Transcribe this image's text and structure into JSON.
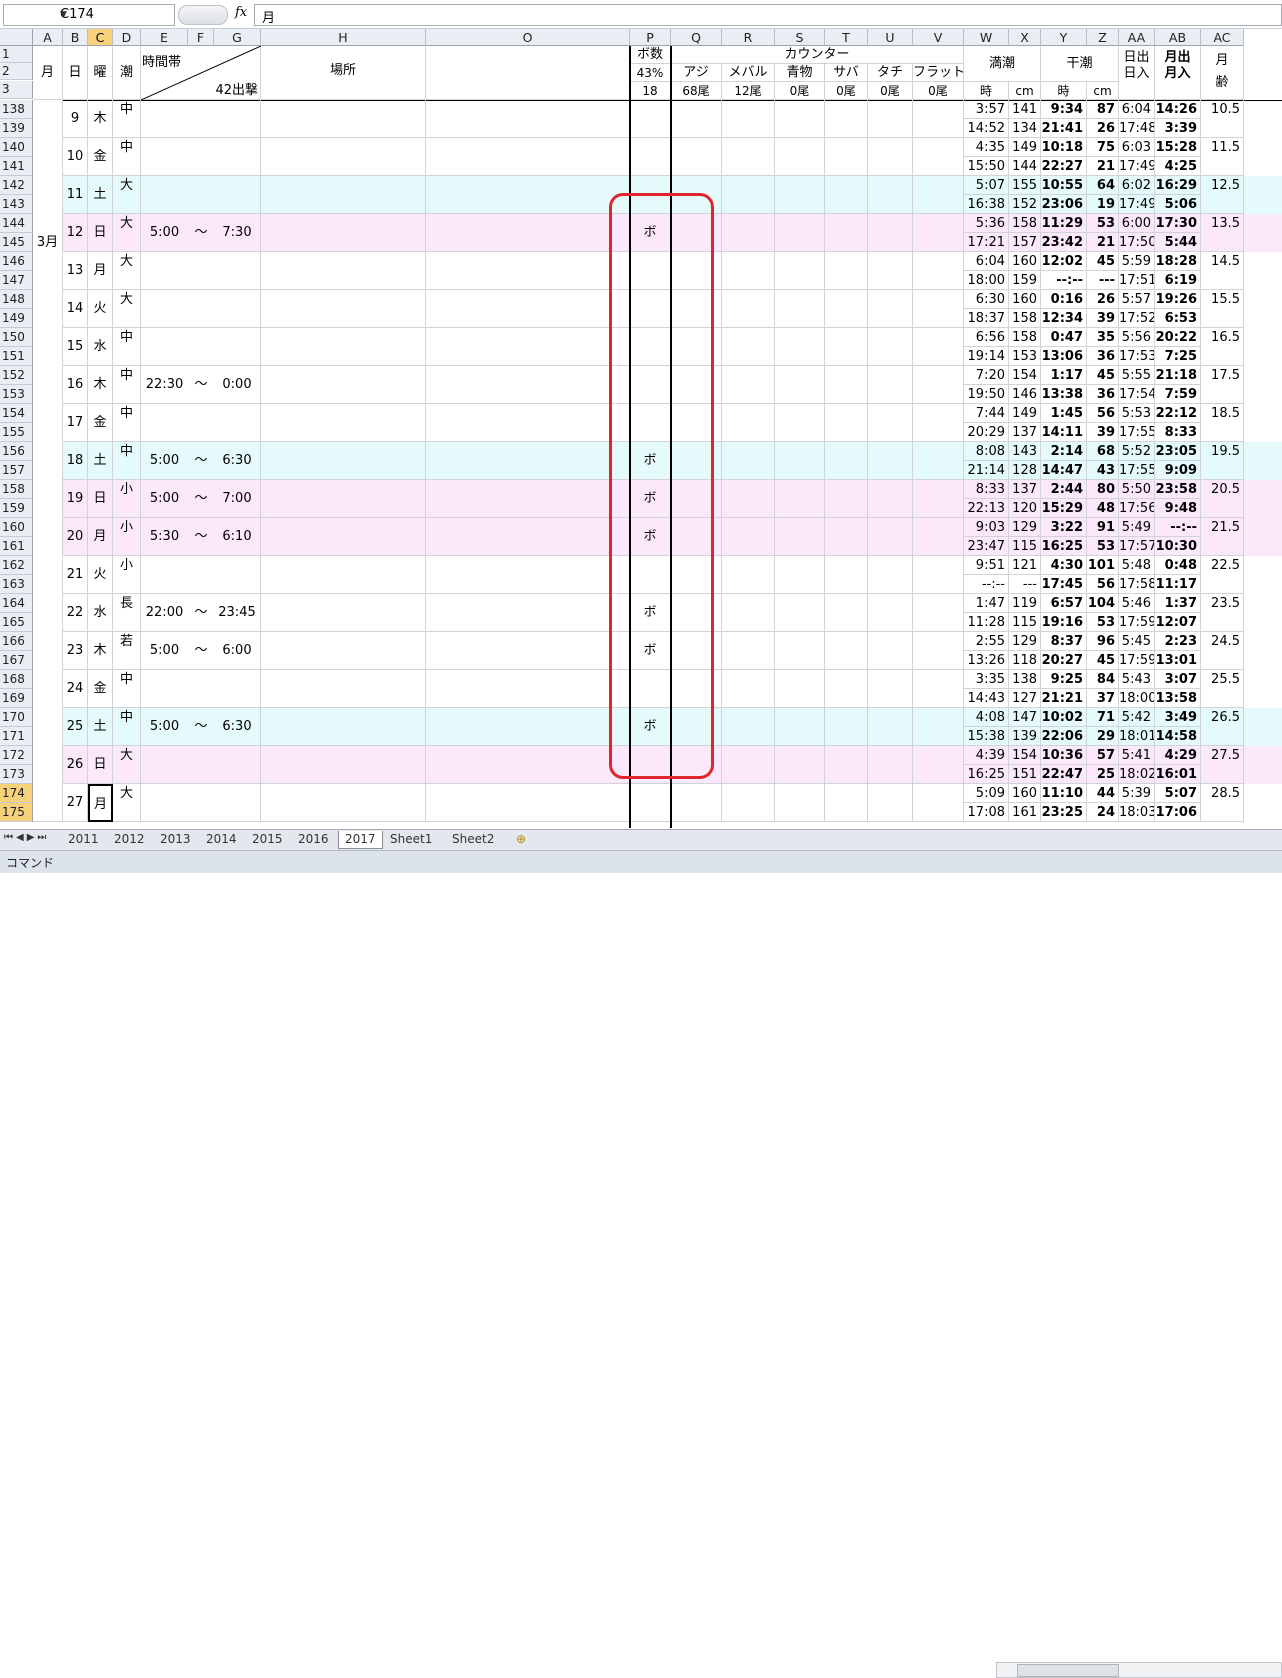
{
  "formula_bar": {
    "name_box": "C174",
    "fx_label": "fx",
    "content": "月"
  },
  "columns": [
    {
      "label": "A",
      "w": 30
    },
    {
      "label": "B",
      "w": 25
    },
    {
      "label": "C",
      "w": 25,
      "sel": true
    },
    {
      "label": "D",
      "w": 28
    },
    {
      "label": "E",
      "w": 47
    },
    {
      "label": "F",
      "w": 26
    },
    {
      "label": "G",
      "w": 47
    },
    {
      "label": "H",
      "w": 165
    },
    {
      "label": "O",
      "w": 204
    },
    {
      "label": "P",
      "w": 41
    },
    {
      "label": "Q",
      "w": 51
    },
    {
      "label": "R",
      "w": 53
    },
    {
      "label": "S",
      "w": 50
    },
    {
      "label": "T",
      "w": 43
    },
    {
      "label": "U",
      "w": 45
    },
    {
      "label": "V",
      "w": 51
    },
    {
      "label": "W",
      "w": 45
    },
    {
      "label": "X",
      "w": 32
    },
    {
      "label": "Y",
      "w": 46
    },
    {
      "label": "Z",
      "w": 32
    },
    {
      "label": "AA",
      "w": 36
    },
    {
      "label": "AB",
      "w": 46
    },
    {
      "label": "AC",
      "w": 43
    }
  ],
  "header_rows": [
    "1",
    "2",
    "3"
  ],
  "header": {
    "month": "月",
    "day": "日",
    "weekday": "曜",
    "tide": "潮",
    "time_band": "時間帯",
    "sorties": "42出撃",
    "place": "場所",
    "bo_count": "ボ数",
    "bo_pct": "43%",
    "bo_num": "18",
    "counter": "カウンター",
    "aji": "アジ",
    "aji_n": "68尾",
    "mebaru": "メバル",
    "mebaru_n": "12尾",
    "aomono": "青物",
    "aomono_n": "0尾",
    "saba": "サバ",
    "saba_n": "0尾",
    "tachi": "タチ",
    "tachi_n": "0尾",
    "flat": "フラット",
    "flat_n": "0尾",
    "high_tide": "満潮",
    "low_tide": "干潮",
    "time": "時",
    "cm": "cm",
    "time2": "時",
    "cm2": "cm",
    "sunrise": "日出",
    "sunset": "日入",
    "moonrise": "月出",
    "moonset": "月入",
    "moon_age_a": "月",
    "moon_age_b": "齢"
  },
  "month_label": "3月",
  "days": [
    {
      "r1": "138",
      "r2": "139",
      "day": "9",
      "wd": "木",
      "tide": "中",
      "from": "",
      "sep": "",
      "to": "",
      "bo": "",
      "band": "",
      "hw1": "3:57",
      "hc1": "141",
      "lw1": "9:34",
      "lc1": "87",
      "sr": "6:04",
      "mr": "14:26",
      "hw2": "14:52",
      "hc2": "134",
      "lw2": "21:41",
      "lc2": "26",
      "ss": "17:48",
      "ms": "3:39",
      "age": "10.5"
    },
    {
      "r1": "140",
      "r2": "141",
      "day": "10",
      "wd": "金",
      "tide": "中",
      "from": "",
      "sep": "",
      "to": "",
      "bo": "",
      "band": "",
      "hw1": "4:35",
      "hc1": "149",
      "lw1": "10:18",
      "lc1": "75",
      "sr": "6:03",
      "mr": "15:28",
      "hw2": "15:50",
      "hc2": "144",
      "lw2": "22:27",
      "lc2": "21",
      "ss": "17:49",
      "ms": "4:25",
      "age": "11.5"
    },
    {
      "r1": "142",
      "r2": "143",
      "day": "11",
      "wd": "土",
      "tide": "大",
      "from": "",
      "sep": "",
      "to": "",
      "bo": "",
      "band": "sat",
      "hw1": "5:07",
      "hc1": "155",
      "lw1": "10:55",
      "lc1": "64",
      "sr": "6:02",
      "mr": "16:29",
      "hw2": "16:38",
      "hc2": "152",
      "lw2": "23:06",
      "lc2": "19",
      "ss": "17:49",
      "ms": "5:06",
      "age": "12.5"
    },
    {
      "r1": "144",
      "r2": "145",
      "day": "12",
      "wd": "日",
      "tide": "大",
      "from": "5:00",
      "sep": "～",
      "to": "7:30",
      "bo": "ボ",
      "band": "sun",
      "hw1": "5:36",
      "hc1": "158",
      "lw1": "11:29",
      "lc1": "53",
      "sr": "6:00",
      "mr": "17:30",
      "hw2": "17:21",
      "hc2": "157",
      "lw2": "23:42",
      "lc2": "21",
      "ss": "17:50",
      "ms": "5:44",
      "age": "13.5"
    },
    {
      "r1": "146",
      "r2": "147",
      "day": "13",
      "wd": "月",
      "tide": "大",
      "from": "",
      "sep": "",
      "to": "",
      "bo": "",
      "band": "",
      "hw1": "6:04",
      "hc1": "160",
      "lw1": "12:02",
      "lc1": "45",
      "sr": "5:59",
      "mr": "18:28",
      "hw2": "18:00",
      "hc2": "159",
      "lw2": "--:--",
      "lc2": "---",
      "ss": "17:51",
      "ms": "6:19",
      "age": "14.5"
    },
    {
      "r1": "148",
      "r2": "149",
      "day": "14",
      "wd": "火",
      "tide": "大",
      "from": "",
      "sep": "",
      "to": "",
      "bo": "",
      "band": "",
      "hw1": "6:30",
      "hc1": "160",
      "lw1": "0:16",
      "lc1": "26",
      "sr": "5:57",
      "mr": "19:26",
      "hw2": "18:37",
      "hc2": "158",
      "lw2": "12:34",
      "lc2": "39",
      "ss": "17:52",
      "ms": "6:53",
      "age": "15.5"
    },
    {
      "r1": "150",
      "r2": "151",
      "day": "15",
      "wd": "水",
      "tide": "中",
      "from": "",
      "sep": "",
      "to": "",
      "bo": "",
      "band": "",
      "hw1": "6:56",
      "hc1": "158",
      "lw1": "0:47",
      "lc1": "35",
      "sr": "5:56",
      "mr": "20:22",
      "hw2": "19:14",
      "hc2": "153",
      "lw2": "13:06",
      "lc2": "36",
      "ss": "17:53",
      "ms": "7:25",
      "age": "16.5"
    },
    {
      "r1": "152",
      "r2": "153",
      "day": "16",
      "wd": "木",
      "tide": "中",
      "from": "22:30",
      "sep": "～",
      "to": "0:00",
      "bo": "",
      "band": "",
      "hw1": "7:20",
      "hc1": "154",
      "lw1": "1:17",
      "lc1": "45",
      "sr": "5:55",
      "mr": "21:18",
      "hw2": "19:50",
      "hc2": "146",
      "lw2": "13:38",
      "lc2": "36",
      "ss": "17:54",
      "ms": "7:59",
      "age": "17.5"
    },
    {
      "r1": "154",
      "r2": "155",
      "day": "17",
      "wd": "金",
      "tide": "中",
      "from": "",
      "sep": "",
      "to": "",
      "bo": "",
      "band": "",
      "hw1": "7:44",
      "hc1": "149",
      "lw1": "1:45",
      "lc1": "56",
      "sr": "5:53",
      "mr": "22:12",
      "hw2": "20:29",
      "hc2": "137",
      "lw2": "14:11",
      "lc2": "39",
      "ss": "17:55",
      "ms": "8:33",
      "age": "18.5"
    },
    {
      "r1": "156",
      "r2": "157",
      "day": "18",
      "wd": "土",
      "tide": "中",
      "from": "5:00",
      "sep": "～",
      "to": "6:30",
      "bo": "ボ",
      "band": "sat",
      "hw1": "8:08",
      "hc1": "143",
      "lw1": "2:14",
      "lc1": "68",
      "sr": "5:52",
      "mr": "23:05",
      "hw2": "21:14",
      "hc2": "128",
      "lw2": "14:47",
      "lc2": "43",
      "ss": "17:55",
      "ms": "9:09",
      "age": "19.5"
    },
    {
      "r1": "158",
      "r2": "159",
      "day": "19",
      "wd": "日",
      "tide": "小",
      "from": "5:00",
      "sep": "～",
      "to": "7:00",
      "bo": "ボ",
      "band": "sun",
      "hw1": "8:33",
      "hc1": "137",
      "lw1": "2:44",
      "lc1": "80",
      "sr": "5:50",
      "mr": "23:58",
      "hw2": "22:13",
      "hc2": "120",
      "lw2": "15:29",
      "lc2": "48",
      "ss": "17:56",
      "ms": "9:48",
      "age": "20.5"
    },
    {
      "r1": "160",
      "r2": "161",
      "day": "20",
      "wd": "月",
      "tide": "小",
      "from": "5:30",
      "sep": "～",
      "to": "6:10",
      "bo": "ボ",
      "band": "sun",
      "hw1": "9:03",
      "hc1": "129",
      "lw1": "3:22",
      "lc1": "91",
      "sr": "5:49",
      "mr": "--:--",
      "hw2": "23:47",
      "hc2": "115",
      "lw2": "16:25",
      "lc2": "53",
      "ss": "17:57",
      "ms": "10:30",
      "age": "21.5"
    },
    {
      "r1": "162",
      "r2": "163",
      "day": "21",
      "wd": "火",
      "tide": "小",
      "from": "",
      "sep": "",
      "to": "",
      "bo": "",
      "band": "",
      "hw1": "9:51",
      "hc1": "121",
      "lw1": "4:30",
      "lc1": "101",
      "sr": "5:48",
      "mr": "0:48",
      "hw2": "--:--",
      "hc2": "---",
      "lw2": "17:45",
      "lc2": "56",
      "ss": "17:58",
      "ms": "11:17",
      "age": "22.5"
    },
    {
      "r1": "164",
      "r2": "165",
      "day": "22",
      "wd": "水",
      "tide": "長",
      "from": "22:00",
      "sep": "～",
      "to": "23:45",
      "bo": "ボ",
      "band": "",
      "hw1": "1:47",
      "hc1": "119",
      "lw1": "6:57",
      "lc1": "104",
      "sr": "5:46",
      "mr": "1:37",
      "hw2": "11:28",
      "hc2": "115",
      "lw2": "19:16",
      "lc2": "53",
      "ss": "17:59",
      "ms": "12:07",
      "age": "23.5"
    },
    {
      "r1": "166",
      "r2": "167",
      "day": "23",
      "wd": "木",
      "tide": "若",
      "from": "5:00",
      "sep": "～",
      "to": "6:00",
      "bo": "ボ",
      "band": "",
      "hw1": "2:55",
      "hc1": "129",
      "lw1": "8:37",
      "lc1": "96",
      "sr": "5:45",
      "mr": "2:23",
      "hw2": "13:26",
      "hc2": "118",
      "lw2": "20:27",
      "lc2": "45",
      "ss": "17:59",
      "ms": "13:01",
      "age": "24.5"
    },
    {
      "r1": "168",
      "r2": "169",
      "day": "24",
      "wd": "金",
      "tide": "中",
      "from": "",
      "sep": "",
      "to": "",
      "bo": "",
      "band": "",
      "hw1": "3:35",
      "hc1": "138",
      "lw1": "9:25",
      "lc1": "84",
      "sr": "5:43",
      "mr": "3:07",
      "hw2": "14:43",
      "hc2": "127",
      "lw2": "21:21",
      "lc2": "37",
      "ss": "18:00",
      "ms": "13:58",
      "age": "25.5"
    },
    {
      "r1": "170",
      "r2": "171",
      "day": "25",
      "wd": "土",
      "tide": "中",
      "from": "5:00",
      "sep": "～",
      "to": "6:30",
      "bo": "ボ",
      "band": "sat",
      "hw1": "4:08",
      "hc1": "147",
      "lw1": "10:02",
      "lc1": "71",
      "sr": "5:42",
      "mr": "3:49",
      "hw2": "15:38",
      "hc2": "139",
      "lw2": "22:06",
      "lc2": "29",
      "ss": "18:01",
      "ms": "14:58",
      "age": "26.5"
    },
    {
      "r1": "172",
      "r2": "173",
      "day": "26",
      "wd": "日",
      "tide": "大",
      "from": "",
      "sep": "",
      "to": "",
      "bo": "",
      "band": "sun",
      "hw1": "4:39",
      "hc1": "154",
      "lw1": "10:36",
      "lc1": "57",
      "sr": "5:41",
      "mr": "4:29",
      "hw2": "16:25",
      "hc2": "151",
      "lw2": "22:47",
      "lc2": "25",
      "ss": "18:02",
      "ms": "16:01",
      "age": "27.5"
    },
    {
      "r1": "174",
      "r2": "175",
      "day": "27",
      "wd": "月",
      "tide": "大",
      "from": "",
      "sep": "",
      "to": "",
      "bo": "",
      "band": "",
      "sel": true,
      "hw1": "5:09",
      "hc1": "160",
      "lw1": "11:10",
      "lc1": "44",
      "sr": "5:39",
      "mr": "5:07",
      "hw2": "17:08",
      "hc2": "161",
      "lw2": "23:25",
      "lc2": "24",
      "ss": "18:03",
      "ms": "17:06",
      "age": "28.5"
    }
  ],
  "sheet_tabs": [
    "2011",
    "2012",
    "2013",
    "2014",
    "2015",
    "2016",
    "2017",
    "Sheet1",
    "Sheet2"
  ],
  "active_tab": "2017",
  "status_text": "コマンド",
  "colors": {
    "sat": "#e5fbfb",
    "sun": "#fce8fb",
    "highlight": "#e0262b",
    "select": "#f8d27b"
  }
}
